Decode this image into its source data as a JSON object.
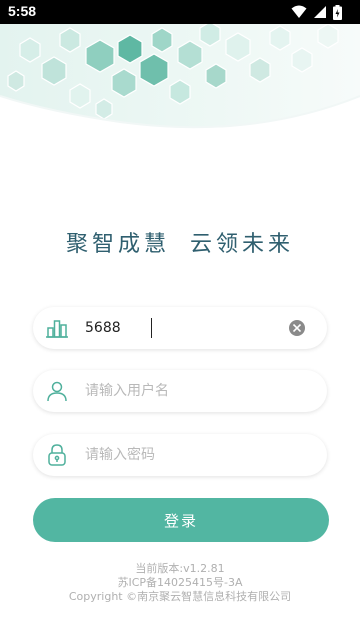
{
  "status_bar": {
    "time": "5:58"
  },
  "slogan": {
    "part1": "聚智成慧",
    "part2": "云领未来"
  },
  "org_field": {
    "value": "5688"
  },
  "username_field": {
    "placeholder": "请输入用户名"
  },
  "password_field": {
    "placeholder": "请输入密码"
  },
  "login_button": {
    "label": "登录"
  },
  "footer": {
    "version": "当前版本:v1.2.81",
    "icp": "苏ICP备14025415号-3A",
    "copyright": "Copyright ©南京聚云智慧信息科技有限公司"
  },
  "colors": {
    "accent": "#52b6a2",
    "slogan": "#2f5f6f",
    "icon": "#4fb09c"
  }
}
